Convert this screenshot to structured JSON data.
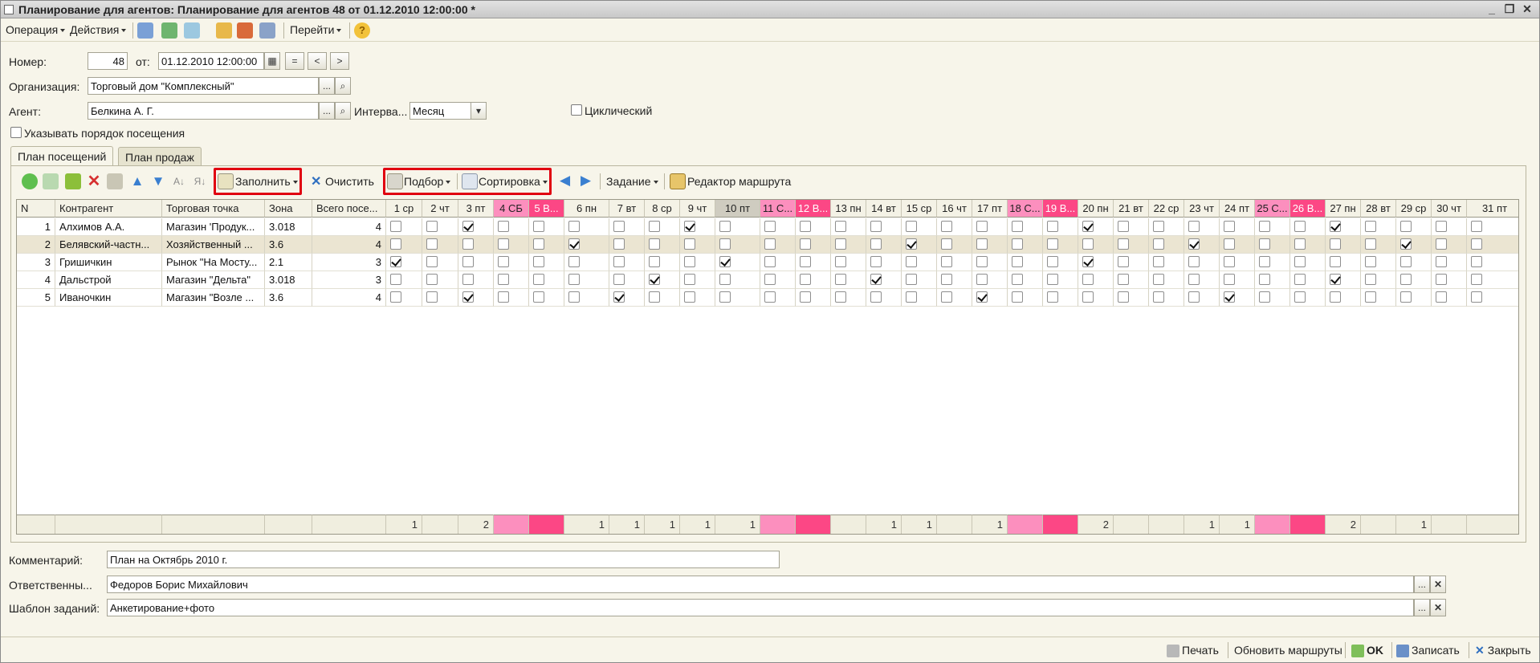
{
  "window": {
    "title": "Планирование для агентов: Планирование для агентов 48 от 01.12.2010 12:00:00 *"
  },
  "menu": {
    "operation": "Операция",
    "actions": "Действия",
    "goto": "Перейти"
  },
  "header": {
    "number_label": "Номер:",
    "number_value": "48",
    "date_label": "от:",
    "date_value": "01.12.2010 12:00:00",
    "btn_eq": "=",
    "btn_prev": "<",
    "btn_next": ">",
    "org_label": "Организация:",
    "org_value": "Торговый дом \"Комплексный\"",
    "agent_label": "Агент:",
    "agent_value": "Белкина А. Г.",
    "interval_label": "Интерва...",
    "interval_value": "Месяц",
    "cyclic_label": "Циклический",
    "order_label": "Указывать порядок посещения",
    "ellipsis": "..."
  },
  "tabs": [
    {
      "label": "План посещений"
    },
    {
      "label": "План продаж"
    }
  ],
  "grid_toolbar": {
    "fill": "Заполнить",
    "clear": "Очистить",
    "pick": "Подбор",
    "sort": "Сортировка",
    "task": "Задание",
    "route_editor": "Редактор маршрута"
  },
  "columns": [
    "N",
    "Контрагент",
    "Торговая точка",
    "Зона",
    "Всего посе..."
  ],
  "days": [
    {
      "label": "1 ср",
      "type": "normal"
    },
    {
      "label": "2 чт",
      "type": "normal"
    },
    {
      "label": "3 пт",
      "type": "normal"
    },
    {
      "label": "4 СБ",
      "type": "sat"
    },
    {
      "label": "5 В...",
      "type": "sun"
    },
    {
      "label": "6 пн",
      "type": "normal"
    },
    {
      "label": "7 вт",
      "type": "normal"
    },
    {
      "label": "8 ср",
      "type": "normal"
    },
    {
      "label": "9 чт",
      "type": "normal"
    },
    {
      "label": "10 пт",
      "type": "today"
    },
    {
      "label": "11 С...",
      "type": "sat"
    },
    {
      "label": "12 В...",
      "type": "sun"
    },
    {
      "label": "13 пн",
      "type": "normal"
    },
    {
      "label": "14 вт",
      "type": "normal"
    },
    {
      "label": "15 ср",
      "type": "normal"
    },
    {
      "label": "16 чт",
      "type": "normal"
    },
    {
      "label": "17 пт",
      "type": "normal"
    },
    {
      "label": "18 С...",
      "type": "sat"
    },
    {
      "label": "19 В...",
      "type": "sun"
    },
    {
      "label": "20 пн",
      "type": "normal"
    },
    {
      "label": "21 вт",
      "type": "normal"
    },
    {
      "label": "22 ср",
      "type": "normal"
    },
    {
      "label": "23 чт",
      "type": "normal"
    },
    {
      "label": "24 пт",
      "type": "normal"
    },
    {
      "label": "25 С...",
      "type": "sat"
    },
    {
      "label": "26 В...",
      "type": "sun"
    },
    {
      "label": "27 пн",
      "type": "normal"
    },
    {
      "label": "28 вт",
      "type": "normal"
    },
    {
      "label": "29 ср",
      "type": "normal"
    },
    {
      "label": "30 чт",
      "type": "normal"
    },
    {
      "label": "31 пт",
      "type": "normal"
    }
  ],
  "rows": [
    {
      "n": "1",
      "contractor": "Алхимов А.А.",
      "outlet": "Магазин 'Продук...",
      "zone": "3.018",
      "total": "4",
      "checked": [
        3,
        9,
        20,
        27
      ]
    },
    {
      "n": "2",
      "contractor": "Белявский-частн...",
      "outlet": "Хозяйственный ...",
      "zone": "3.6",
      "total": "4",
      "checked": [
        6,
        15,
        23,
        29
      ]
    },
    {
      "n": "3",
      "contractor": "Гришичкин",
      "outlet": "Рынок \"На Мосту...",
      "zone": "2.1",
      "total": "3",
      "checked": [
        1,
        10,
        20
      ]
    },
    {
      "n": "4",
      "contractor": "Дальстрой",
      "outlet": "Магазин \"Дельта\"",
      "zone": "3.018",
      "total": "3",
      "checked": [
        8,
        14,
        27
      ]
    },
    {
      "n": "5",
      "contractor": "Иваночкин",
      "outlet": "Магазин \"Возле ...",
      "zone": "3.6",
      "total": "4",
      "checked": [
        3,
        7,
        17,
        24
      ]
    }
  ],
  "totals": [
    "1",
    "",
    "2",
    "",
    "",
    "1",
    "1",
    "1",
    "1",
    "1",
    "",
    "",
    "",
    "1",
    "1",
    "",
    "1",
    "",
    "",
    "2",
    "",
    "",
    "1",
    "1",
    "",
    "",
    "2",
    "",
    "1",
    "",
    ""
  ],
  "footer_fields": {
    "comment_label": "Комментарий:",
    "comment_value": "План на Октябрь 2010 г.",
    "resp_label": "Ответственны...",
    "resp_value": "Федоров Борис Михайлович",
    "tmpl_label": "Шаблон заданий:",
    "tmpl_value": "Анкетирование+фото"
  },
  "bottom": {
    "print": "Печать",
    "update_routes": "Обновить маршруты",
    "ok": "OK",
    "save": "Записать",
    "close": "Закрыть"
  },
  "colors": {
    "sat": "#fc8fbe",
    "sun": "#fc4785",
    "today": "#cfccc0",
    "highlight": "#e00010"
  }
}
